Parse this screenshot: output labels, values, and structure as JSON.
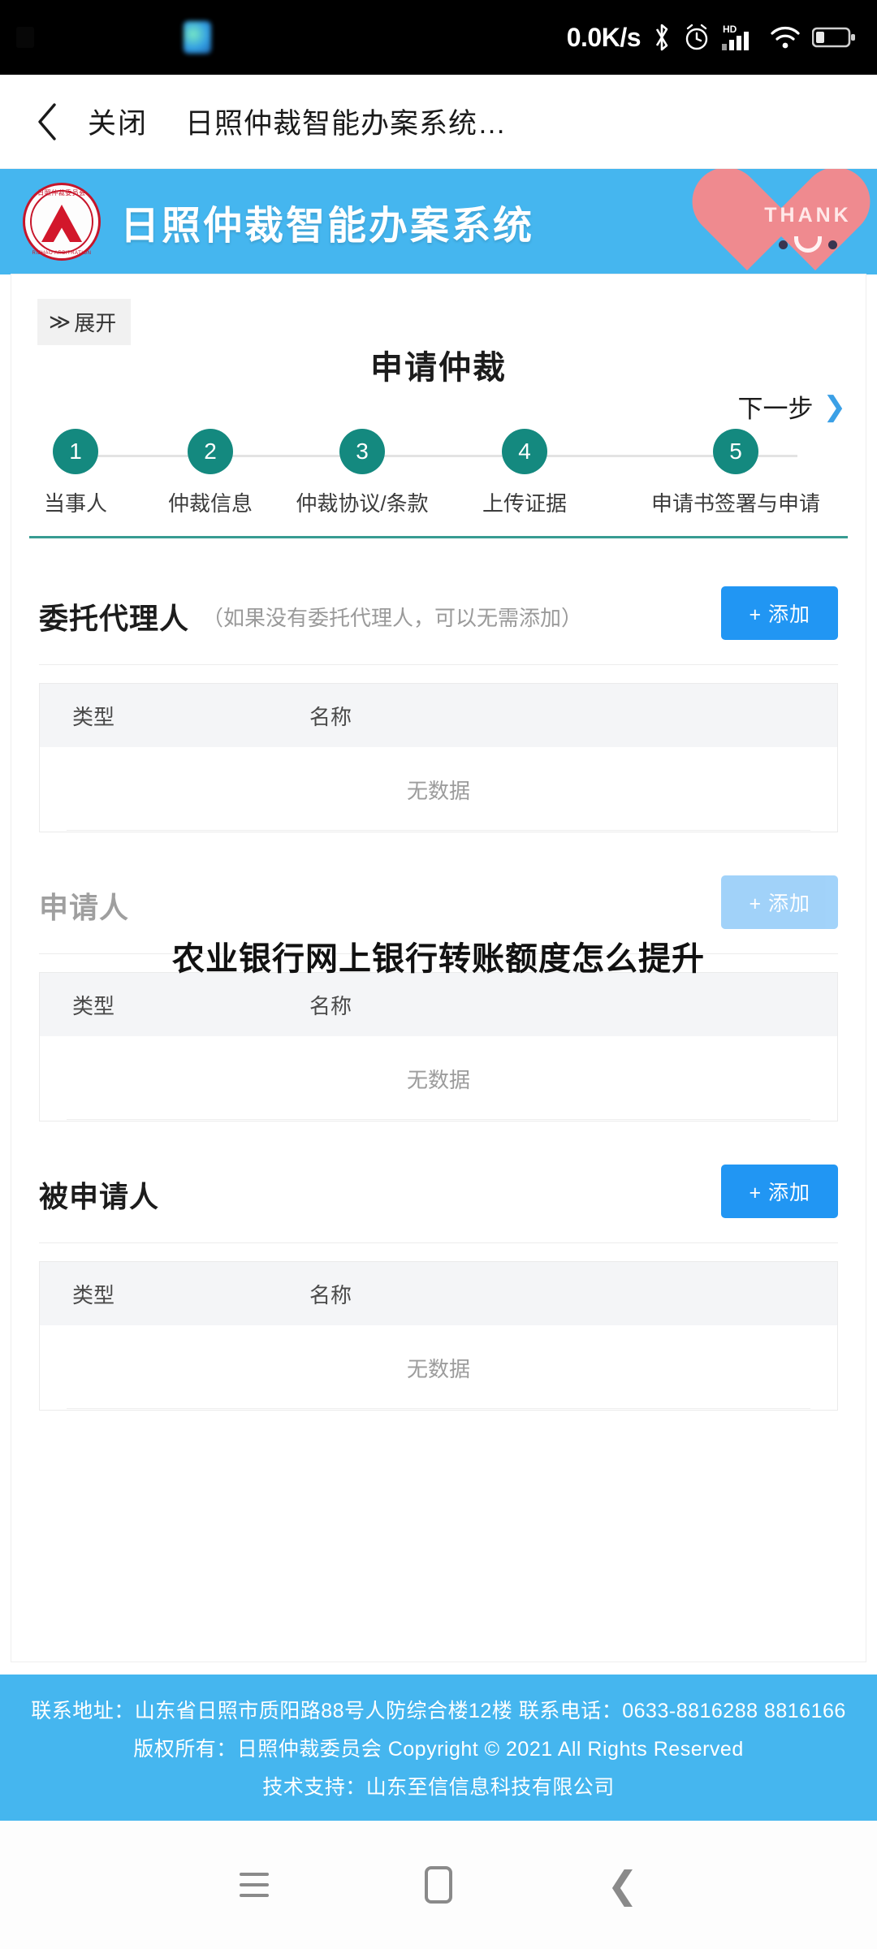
{
  "statusbar": {
    "network_speed": "0.0K/s",
    "icons": [
      "bluetooth-icon",
      "alarm-icon",
      "hd-signal-icon",
      "wifi-icon",
      "battery-icon"
    ],
    "hd_label": "HD"
  },
  "navbar": {
    "back_icon": "chevron-left-icon",
    "close_label": "关闭",
    "title": "日照仲裁智能办案系统…"
  },
  "banner": {
    "logo_name": "rizhao-arbitration-crest",
    "title": "日照仲裁智能办案系统",
    "badge_text": "THANK",
    "badge_face": "U"
  },
  "page": {
    "expand_label": "展开",
    "expand_icon": "double-chevron-right-icon",
    "title": "申请仲裁",
    "next_step_label": "下一步",
    "next_step_icon": "chevron-right-icon",
    "steps": [
      {
        "number": "1",
        "label": "当事人"
      },
      {
        "number": "2",
        "label": "仲裁信息"
      },
      {
        "number": "3",
        "label": "仲裁协议/条款"
      },
      {
        "number": "4",
        "label": "上传证据"
      },
      {
        "number": "5",
        "label": "申请书签署与申请"
      }
    ],
    "table_headers": {
      "type": "类型",
      "name": "名称"
    },
    "empty_text": "无数据",
    "add_label": "+ 添加",
    "sections": [
      {
        "title": "委托代理人",
        "note": "（如果没有委托代理人，可以无需添加）"
      },
      {
        "title": "申请人",
        "note": ""
      },
      {
        "title": "被申请人",
        "note": ""
      }
    ]
  },
  "overlay": {
    "watermark_text": "农业银行网上银行转账额度怎么提升"
  },
  "footer": {
    "line1": "联系地址：山东省日照市质阳路88号人防综合楼12楼  联系电话：0633-8816288 8816166",
    "line2": "版权所有：日照仲裁委员会 Copyright © 2021 All Rights Reserved",
    "line3": "技术支持：山东至信信息科技有限公司"
  },
  "androidnav": {
    "recent_label": "recent-apps",
    "home_label": "home",
    "back_label": "back"
  },
  "colors": {
    "banner_blue": "#45b6ef",
    "accent_blue": "#2196f3",
    "step_teal": "#14897f",
    "heart_pink": "#ef8a8f"
  }
}
